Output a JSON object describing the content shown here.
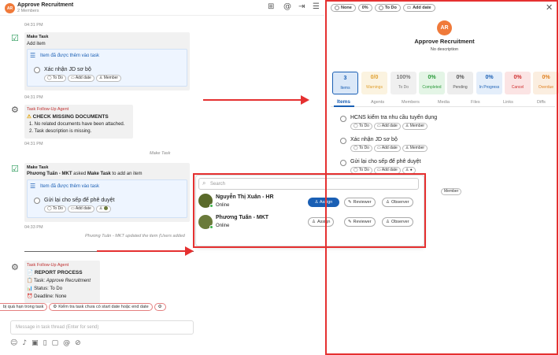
{
  "header": {
    "avatar": "AR",
    "title": "Approve Recruitment",
    "members": "2 Members"
  },
  "chat": {
    "times": [
      "04:31 PM",
      "04:31 PM",
      "04:31 PM",
      "04:33 PM"
    ],
    "msg1": {
      "sender": "Make Task",
      "text": "Add item",
      "box_title": "Item đã được thêm vào task",
      "item": "Xác nhận JD sơ bộ"
    },
    "msg2": {
      "sender": "Task Follow-Up Agent",
      "title": "CHECK MISSING DOCUMENTS",
      "line1": "1. No related documents have been attached.",
      "line2": "2. Task description is missing."
    },
    "make_task_label": "Make Task",
    "msg3": {
      "sender": "Make Task",
      "text_a": "Phương Tuấn - MKT",
      "text_b": " asked ",
      "text_c": "Make Task",
      "text_d": " to add an item",
      "box_title": "Item đã được thêm vào task",
      "item": "Gửi lại cho sếp để phê duyệt"
    },
    "updated_note": "Phương Tuấn - MKT updated the item (Users added",
    "msg4": {
      "sender": "Task Follow-Up Agent",
      "title": "REPORT PROCESS",
      "task_label": "Task: ",
      "task_value": "Approve Recruitment",
      "status": "Status: To Do",
      "deadline": "Deadline: None"
    },
    "suggestions": [
      "bị quá hạn trong task",
      "Kiểm tra task chưa có start date hoặc end date"
    ],
    "input_placeholder": "Message in task thread (Enter for send)"
  },
  "chips": {
    "todo": "To Do",
    "add_date": "Add date",
    "member": "Member"
  },
  "panel": {
    "none": "None",
    "pct": "0%",
    "todo": "To Do",
    "add_date": "Add date",
    "avatar": "AR",
    "title": "Approve Recruitment",
    "desc": "No description",
    "stats": [
      {
        "num": "3",
        "label": "Items",
        "color": "#1a5fb4",
        "bg": "#dbe8f8"
      },
      {
        "num": "0/0",
        "label": "Warnings",
        "color": "#e0a030",
        "bg": "#fbf3e0"
      },
      {
        "num": "100%",
        "label": "To Do",
        "color": "#777",
        "bg": "#f0f0f0"
      },
      {
        "num": "0%",
        "label": "Completed",
        "color": "#2a9a3a",
        "bg": "#e4f5e6"
      },
      {
        "num": "0%",
        "label": "Pending",
        "color": "#555",
        "bg": "#ededed"
      },
      {
        "num": "0%",
        "label": "In Progress",
        "color": "#1a5fb4",
        "bg": "#e4eefa"
      },
      {
        "num": "0%",
        "label": "Cancel",
        "color": "#d03030",
        "bg": "#fbe4e4"
      },
      {
        "num": "0%",
        "label": "Overdue",
        "color": "#e08020",
        "bg": "#fbeee0"
      }
    ],
    "tabs": [
      "Items",
      "Agents",
      "Members",
      "Media",
      "Files",
      "Links",
      "Diffs"
    ],
    "items": [
      "HCNS kiểm tra nhu cầu tuyển dụng",
      "Xác nhận JD sơ bộ",
      "Gửi lại cho sếp để phê duyệt"
    ]
  },
  "popup": {
    "search": "Search",
    "users": [
      {
        "name": "Nguyễn Thị Xuân - HR",
        "status": "Online"
      },
      {
        "name": "Phương Tuấn - MKT",
        "status": "Online"
      }
    ],
    "assign": "Assign",
    "reviewer": "Reviewer",
    "observer": "Observer"
  },
  "colors": {
    "red": "#e53030",
    "accent": "#1a5fb4",
    "orange": "#f07a3a"
  }
}
